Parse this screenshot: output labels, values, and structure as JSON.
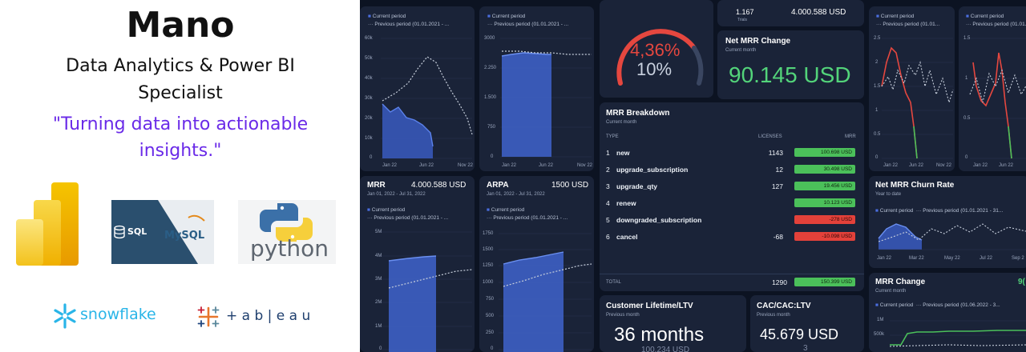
{
  "profile": {
    "name": "Mano",
    "role_line1": "Data Analytics & Power BI",
    "role_line2": "Specialist",
    "tagline_line1": "\"Turning data into actionable",
    "tagline_line2": "insights.\"",
    "logos": {
      "powerbi": "power-bi-logo",
      "sql_label": "SQL",
      "mysql_label": "MySQL",
      "python_label": "python",
      "snowflake_label": "snowflake",
      "tableau_label": "+ a b | e a u"
    }
  },
  "dashboard": {
    "legend_current": "Current period",
    "legend_previous": "Previous period (01.01.2021 - ...",
    "legend_previous_short": "Previous period (01.01...",
    "legend_previous_long": "Previous period (01.01.2021 - 31...",
    "legend_previous_mrr_change": "Previous period (01.06.2022 - 3...",
    "top_left_chart": {
      "y_ticks": [
        "60k",
        "50k",
        "40k",
        "30k",
        "20k",
        "10k",
        "0"
      ],
      "x_ticks": [
        "Jan 22",
        "Jun 22",
        "Nov 22"
      ]
    },
    "top_mid_chart": {
      "y_ticks": [
        "3000",
        "2.250",
        "1.500",
        "750",
        "0"
      ],
      "x_ticks": [
        "Jan 22",
        "Jun 22",
        "Nov 22"
      ]
    },
    "gauge": {
      "value_pct": "4,36%",
      "target_pct": "10%"
    },
    "top_stats": {
      "left_value": "1.167",
      "left_sub": "Trials",
      "right_value": "4.000.588 USD"
    },
    "net_mrr_change": {
      "title": "Net MRR Change",
      "subtitle": "Current month",
      "value": "90.145 USD"
    },
    "mrr_breakdown": {
      "title": "MRR Breakdown",
      "subtitle": "Current month",
      "col_type": "TYPE",
      "col_licenses": "LICENSES",
      "col_mrr": "MRR",
      "rows": [
        {
          "idx": "1",
          "type": "new",
          "licenses": "1143",
          "mrr": "100.698 USD",
          "status": "positive"
        },
        {
          "idx": "2",
          "type": "upgrade_subscription",
          "licenses": "12",
          "mrr": "30.498 USD",
          "status": "positive"
        },
        {
          "idx": "3",
          "type": "upgrade_qty",
          "licenses": "127",
          "mrr": "19.456 USD",
          "status": "positive"
        },
        {
          "idx": "4",
          "type": "renew",
          "licenses": "",
          "mrr": "10.123 USD",
          "status": "positive"
        },
        {
          "idx": "5",
          "type": "downgraded_subscription",
          "licenses": "",
          "mrr": "-278 USD",
          "status": "negative"
        },
        {
          "idx": "6",
          "type": "cancel",
          "licenses": "-68",
          "mrr": "-10.098 USD",
          "status": "negative"
        }
      ],
      "total_label": "TOTAL",
      "total_licenses": "1290",
      "total_mrr": "150.399 USD"
    },
    "mrr_card": {
      "title": "MRR",
      "value": "4.000.588 USD",
      "date_range": "Jan 01, 2022 - Jul 31, 2022",
      "y_ticks": [
        "5M",
        "4M",
        "3M",
        "2M",
        "1M",
        "0"
      ]
    },
    "arpa_card": {
      "title": "ARPA",
      "value": "1500 USD",
      "date_range": "Jan 01, 2022 - Jul 31, 2022",
      "y_ticks": [
        "1750",
        "1500",
        "1250",
        "1000",
        "750",
        "500",
        "250",
        "0"
      ]
    },
    "ltv_card": {
      "title": "Customer Lifetime/LTV",
      "subtitle": "Previous month",
      "value": "36 months",
      "sub_value": "100.234 USD"
    },
    "cac_card": {
      "title": "CAC/CAC:LTV",
      "subtitle": "Previous month",
      "value": "45.679 USD",
      "sub_value": "3"
    },
    "right_chart_1": {
      "y_ticks": [
        "2.5",
        "2",
        "1.5",
        "1",
        "0.5",
        "0"
      ],
      "x_ticks": [
        "Jan 22",
        "Jun 22",
        "Nov 22"
      ]
    },
    "right_chart_2": {
      "y_ticks": [
        "1.5",
        "1",
        "0.5",
        "0"
      ],
      "x_ticks": [
        "Jan 22",
        "Jun 22"
      ]
    },
    "net_mrr_churn": {
      "title": "Net MRR Churn Rate",
      "subtitle": "Year to date",
      "x_ticks": [
        "Jan 22",
        "Mar 22",
        "May 22",
        "Jul 22",
        "Sep 2"
      ]
    },
    "mrr_change": {
      "title": "MRR Change",
      "subtitle": "Current month",
      "value_partial": "9(",
      "y_ticks": [
        "1M",
        "500k"
      ]
    }
  },
  "colors": {
    "dash_bg": "#0c1322",
    "card_bg": "#1a2338",
    "series_current": "#4a6ee0",
    "series_previous": "#c7cfdc",
    "positive": "#4bc05a",
    "negative": "#e3413a",
    "accent_purple": "#6a2ae8",
    "big_red": "#e5473f",
    "big_green": "#53d47a"
  }
}
